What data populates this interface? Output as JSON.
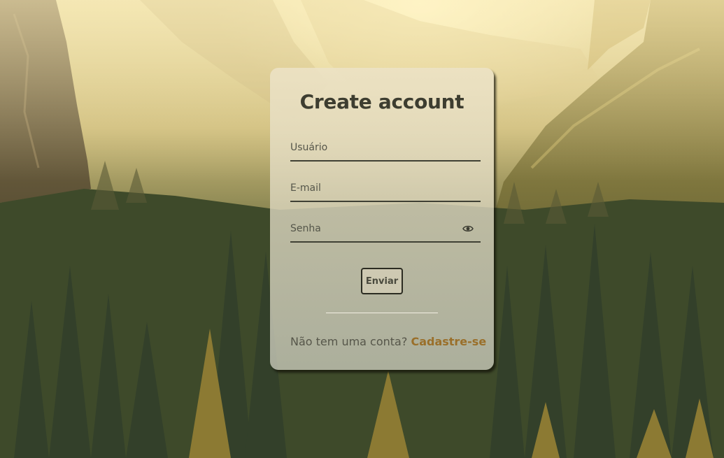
{
  "form": {
    "title": "Create account",
    "username_placeholder": "Usuário",
    "email_placeholder": "E-mail",
    "password_placeholder": "Senha",
    "password_toggle_icon": "eye-icon",
    "submit_label": "Enviar",
    "signup_prompt": "Não tem uma conta?",
    "signup_link": "Cadastre-se"
  },
  "colors": {
    "title": "#3d3d30",
    "link": "#9a6f2a",
    "field_border": "#3f4034"
  }
}
